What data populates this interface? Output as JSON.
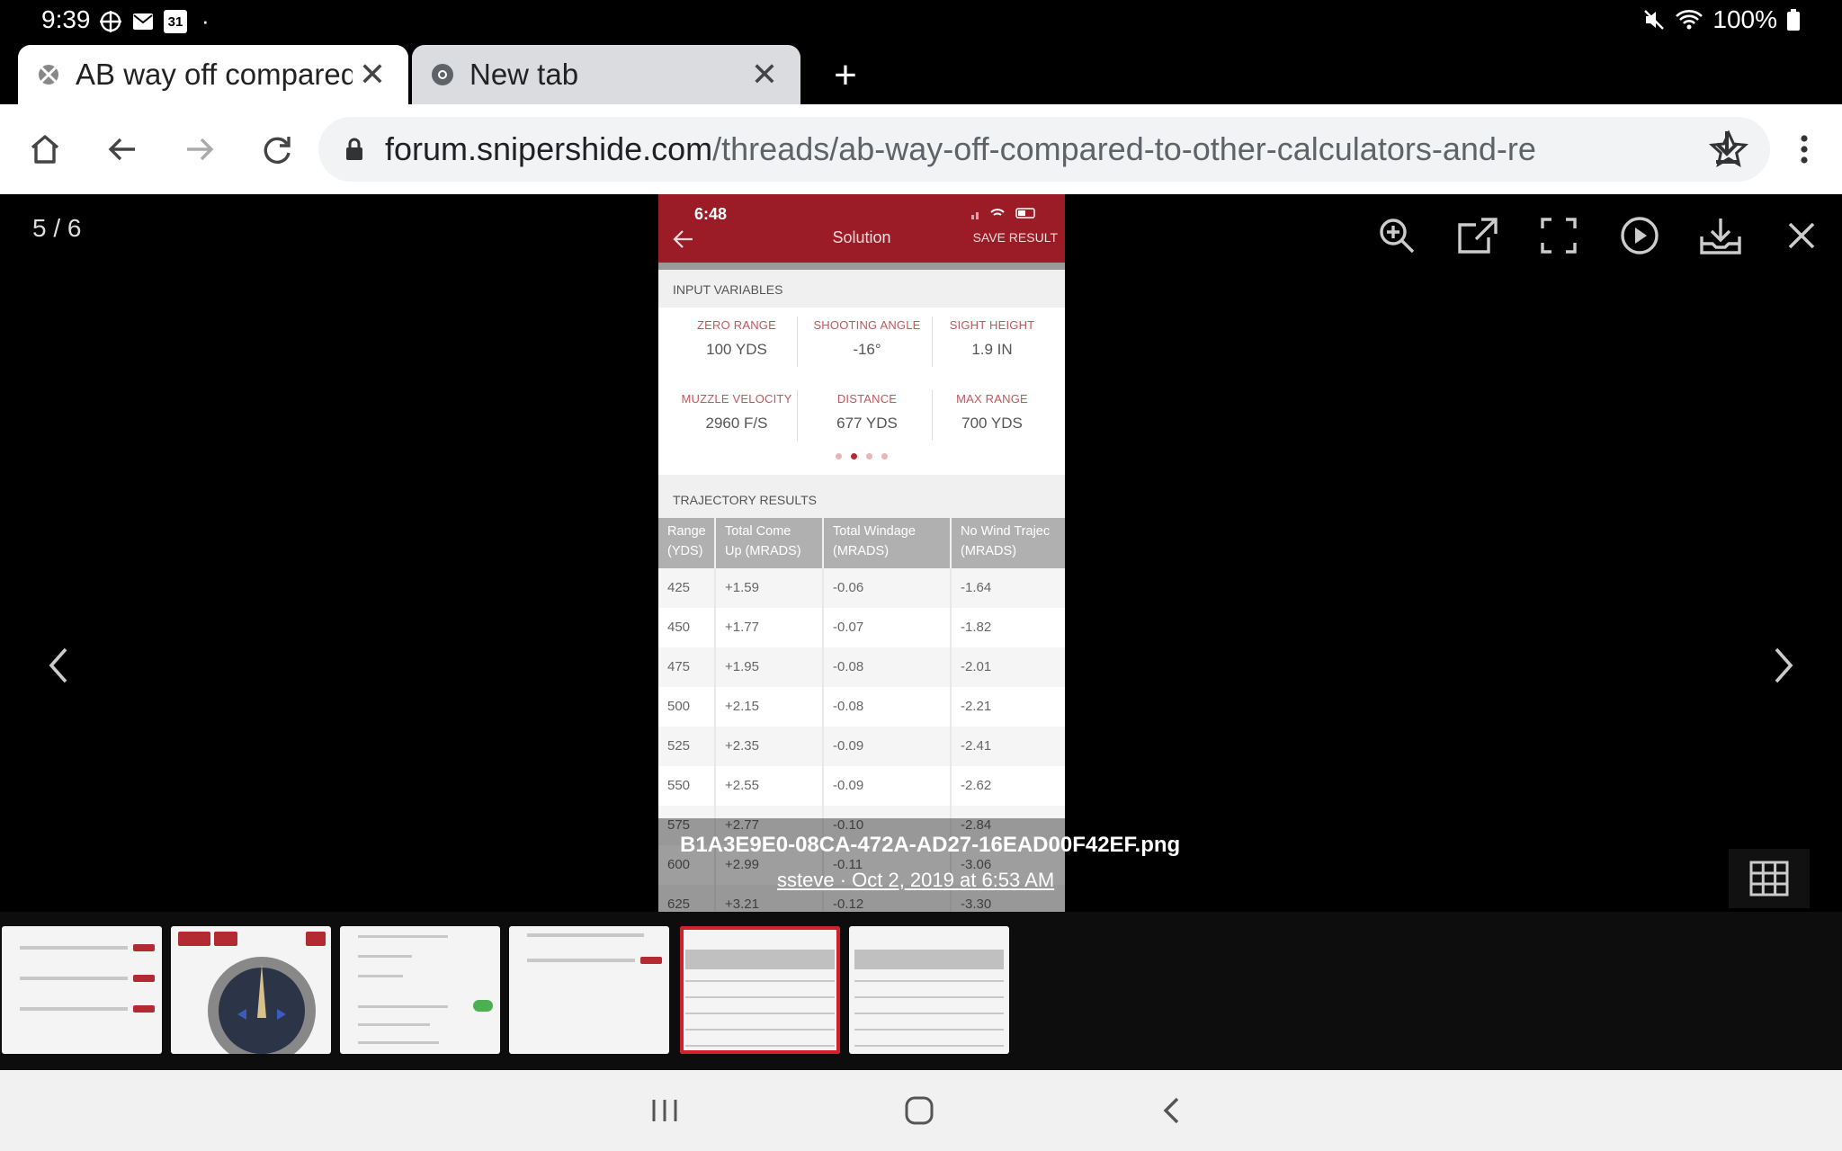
{
  "status_bar": {
    "time": "9:39",
    "calendar_day": "31",
    "battery": "100%"
  },
  "tabs": [
    {
      "title": "AB way off compared",
      "active": true
    },
    {
      "title": "New tab",
      "active": false
    }
  ],
  "omnibox": {
    "host": "forum.snipershide.com",
    "path": "/threads/ab-way-off-compared-to-other-calculators-and-re"
  },
  "lightbox": {
    "counter": "5 / 6",
    "filename": "B1A3E9E0-08CA-472A-AD27-16EAD00F42EF.png",
    "byline": "ssteve · Oct 2, 2019 at 6:53 AM"
  },
  "phone": {
    "time": "6:48",
    "title": "Solution",
    "save_label": "SAVE RESULT",
    "input_section": "INPUT VARIABLES",
    "inputs": [
      {
        "label": "ZERO RANGE",
        "value": "100 YDS"
      },
      {
        "label": "SHOOTING ANGLE",
        "value": "-16°"
      },
      {
        "label": "SIGHT HEIGHT",
        "value": "1.9 IN"
      },
      {
        "label": "MUZZLE VELOCITY",
        "value": "2960 F/S"
      },
      {
        "label": "DISTANCE",
        "value": "677 YDS"
      },
      {
        "label": "MAX RANGE",
        "value": "700 YDS"
      }
    ],
    "results_section": "TRAJECTORY RESULTS",
    "columns": [
      [
        "Range",
        "(YDS)"
      ],
      [
        "Total Come",
        "Up (MRADS)"
      ],
      [
        "Total Windage",
        "(MRADS)"
      ],
      [
        "No Wind Trajec",
        "(MRADS)"
      ]
    ],
    "rows": [
      [
        "425",
        "+1.59",
        "-0.06",
        "-1.64"
      ],
      [
        "450",
        "+1.77",
        "-0.07",
        "-1.82"
      ],
      [
        "475",
        "+1.95",
        "-0.08",
        "-2.01"
      ],
      [
        "500",
        "+2.15",
        "-0.08",
        "-2.21"
      ],
      [
        "525",
        "+2.35",
        "-0.09",
        "-2.41"
      ],
      [
        "550",
        "+2.55",
        "-0.09",
        "-2.62"
      ],
      [
        "575",
        "+2.77",
        "-0.10",
        "-2.84"
      ],
      [
        "600",
        "+2.99",
        "-0.11",
        "-3.06"
      ],
      [
        "625",
        "+3.21",
        "-0.12",
        "-3.30"
      ]
    ]
  }
}
